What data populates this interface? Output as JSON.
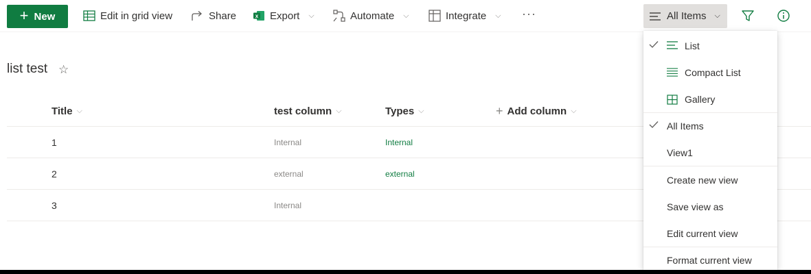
{
  "toolbar": {
    "new_label": "New",
    "edit_grid_label": "Edit in grid view",
    "share_label": "Share",
    "export_label": "Export",
    "automate_label": "Automate",
    "integrate_label": "Integrate",
    "more_label": "···",
    "view_selector_label": "All Items"
  },
  "list": {
    "title": "list test",
    "columns": [
      "Title",
      "test column",
      "Types",
      "Add column"
    ],
    "rows": [
      {
        "title": "1",
        "test_column": "Internal",
        "types": "Internal"
      },
      {
        "title": "2",
        "test_column": "external",
        "types": "external"
      },
      {
        "title": "3",
        "test_column": "Internal",
        "types": ""
      }
    ]
  },
  "view_menu": {
    "layouts": [
      {
        "label": "List",
        "icon": "list-icon",
        "checked": true
      },
      {
        "label": "Compact List",
        "icon": "compact-list-icon",
        "checked": false
      },
      {
        "label": "Gallery",
        "icon": "gallery-icon",
        "checked": false
      }
    ],
    "views": [
      {
        "label": "All Items",
        "checked": true
      },
      {
        "label": "View1",
        "checked": false
      }
    ],
    "actions": [
      {
        "label": "Create new view"
      },
      {
        "label": "Save view as"
      },
      {
        "label": "Edit current view"
      }
    ],
    "format": {
      "label": "Format current view"
    }
  },
  "colors": {
    "accent_green": "#107c41",
    "selector_bg": "#e1dfdd",
    "muted_text": "#8a8886"
  }
}
